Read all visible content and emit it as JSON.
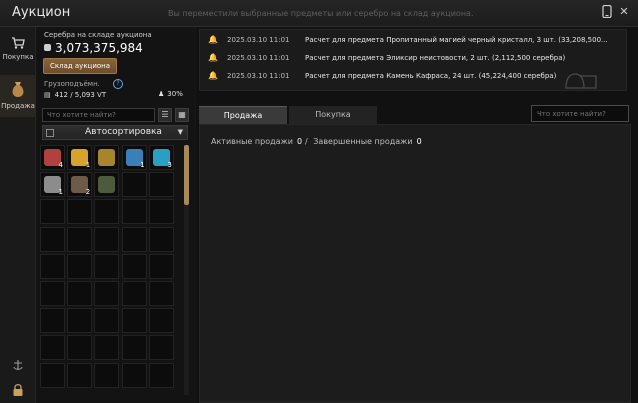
{
  "window": {
    "title": "Аукцион",
    "notice": "Вы переместили выбранные предметы или серебро на склад аукциона."
  },
  "sidebar": {
    "items": [
      {
        "label": "Покупка",
        "icon": "cart-icon"
      },
      {
        "label": "Продажа",
        "icon": "money-bag-icon"
      }
    ]
  },
  "left_panel": {
    "silver_label": "Серебра на складе аукциона",
    "silver_value": "3,073,375,984",
    "warehouse_button": "Склад аукциона",
    "weight_label": "Грузоподъёмн.",
    "weight_value": "412 / 5,093 VT",
    "weight_percent": "30%",
    "search_placeholder": "Что хотите найти?",
    "sort_label": "Автосортировка",
    "inventory": [
      {
        "icon": "meat-icon",
        "count": "4",
        "color": "#b0413c"
      },
      {
        "icon": "gold-coin-icon",
        "count": "1",
        "color": "#d9a22a"
      },
      {
        "icon": "treasure-pile-icon",
        "count": "",
        "color": "#a8842c"
      },
      {
        "icon": "potion-icon",
        "count": "1",
        "color": "#3b7fb8"
      },
      {
        "icon": "crystal-icon",
        "count": "3",
        "color": "#2a9fc4"
      },
      {
        "icon": "skull-icon",
        "count": "1",
        "color": "#8c8c8c"
      },
      {
        "icon": "ore-icon",
        "count": "2",
        "color": "#6b5b48"
      },
      {
        "icon": "bow-icon",
        "count": "",
        "color": "#4d5a3b"
      }
    ]
  },
  "notifications": [
    {
      "date": "2025.03.10 11:01",
      "text": "Расчет для предмета Пропитанный магией черный кристалл, 3 шт. (33,208,500..."
    },
    {
      "date": "2025.03.10 11:01",
      "text": "Расчет для предмета Эликсир неистовости, 2 шт. (2,112,500 серебра)"
    },
    {
      "date": "2025.03.10 11:01",
      "text": "Расчет для предмета Камень Кафраса, 24 шт. (45,224,400 серебра)"
    }
  ],
  "tabs": [
    {
      "label": "Продажа"
    },
    {
      "label": "Покупка"
    }
  ],
  "right_search_placeholder": "Что хотите найти?",
  "sales": {
    "active_label": "Активные продажи",
    "active_count": "0",
    "separator": "/",
    "done_label": "Завершенные продажи",
    "done_count": "0"
  }
}
